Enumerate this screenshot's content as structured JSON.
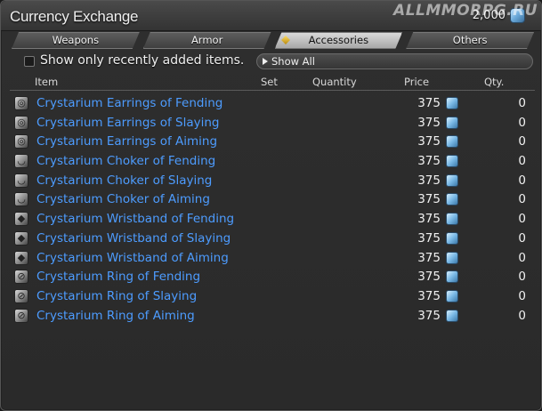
{
  "window": {
    "title": "Currency Exchange",
    "currency_amount": "2,000",
    "watermark": "ALLMMORPG.RU"
  },
  "tabs": [
    {
      "label": "Weapons",
      "active": false
    },
    {
      "label": "Armor",
      "active": false
    },
    {
      "label": "Accessories",
      "active": true
    },
    {
      "label": "Others",
      "active": false
    }
  ],
  "filters": {
    "checkbox_label": "Show only recently added items.",
    "checkbox_checked": false,
    "dropdown_value": "Show All"
  },
  "columns": {
    "item": "Item",
    "set": "Set",
    "quantity": "Quantity",
    "price": "Price",
    "qty": "Qty."
  },
  "items": [
    {
      "name": "Crystarium Earrings of Fending",
      "icon": "earring-icon",
      "price": "375",
      "qty": "0"
    },
    {
      "name": "Crystarium Earrings of Slaying",
      "icon": "earring-icon",
      "price": "375",
      "qty": "0"
    },
    {
      "name": "Crystarium Earrings of Aiming",
      "icon": "earring-icon",
      "price": "375",
      "qty": "0"
    },
    {
      "name": "Crystarium Choker of Fending",
      "icon": "necklace-icon",
      "price": "375",
      "qty": "0"
    },
    {
      "name": "Crystarium Choker of Slaying",
      "icon": "necklace-icon",
      "price": "375",
      "qty": "0"
    },
    {
      "name": "Crystarium Choker of Aiming",
      "icon": "necklace-icon",
      "price": "375",
      "qty": "0"
    },
    {
      "name": "Crystarium Wristband of Fending",
      "icon": "bracelet-icon",
      "price": "375",
      "qty": "0"
    },
    {
      "name": "Crystarium Wristband of Slaying",
      "icon": "bracelet-icon",
      "price": "375",
      "qty": "0"
    },
    {
      "name": "Crystarium Wristband of Aiming",
      "icon": "bracelet-icon",
      "price": "375",
      "qty": "0"
    },
    {
      "name": "Crystarium Ring of Fending",
      "icon": "ring-icon",
      "price": "375",
      "qty": "0"
    },
    {
      "name": "Crystarium Ring of Slaying",
      "icon": "ring-icon",
      "price": "375",
      "qty": "0"
    },
    {
      "name": "Crystarium Ring of Aiming",
      "icon": "ring-icon",
      "price": "375",
      "qty": "0"
    }
  ],
  "colors": {
    "item_name": "#4d9cff",
    "active_tab": "#c8c8c8",
    "window_bg": "#2a2a2a"
  }
}
